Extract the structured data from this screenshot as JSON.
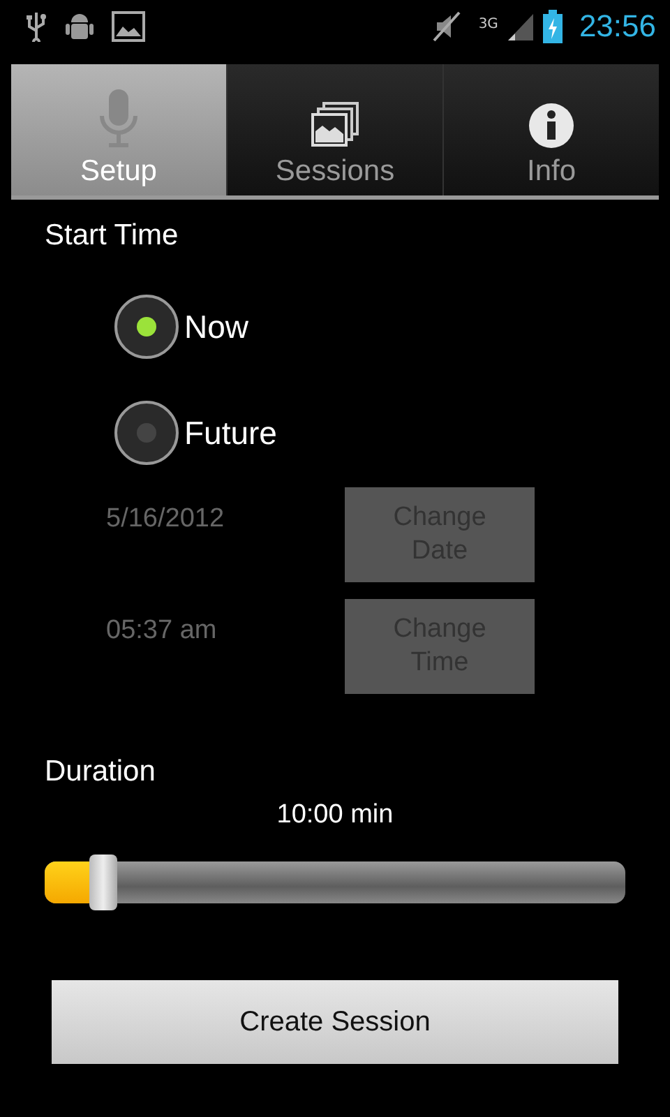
{
  "status_bar": {
    "network": "3G",
    "time": "23:56"
  },
  "tabs": [
    {
      "label": "Setup",
      "selected": true
    },
    {
      "label": "Sessions",
      "selected": false
    },
    {
      "label": "Info",
      "selected": false
    }
  ],
  "start_time": {
    "label": "Start Time",
    "options": [
      {
        "label": "Now",
        "selected": true
      },
      {
        "label": "Future",
        "selected": false
      }
    ],
    "rows": [
      {
        "value": "5/16/2012",
        "button": "Change Date",
        "disabled": true
      },
      {
        "value": "05:37 am",
        "button": "Change Time",
        "disabled": true
      }
    ]
  },
  "duration": {
    "label": "Duration",
    "reading": "10:00 min",
    "level": 0.1
  },
  "create_button": "Create Session"
}
